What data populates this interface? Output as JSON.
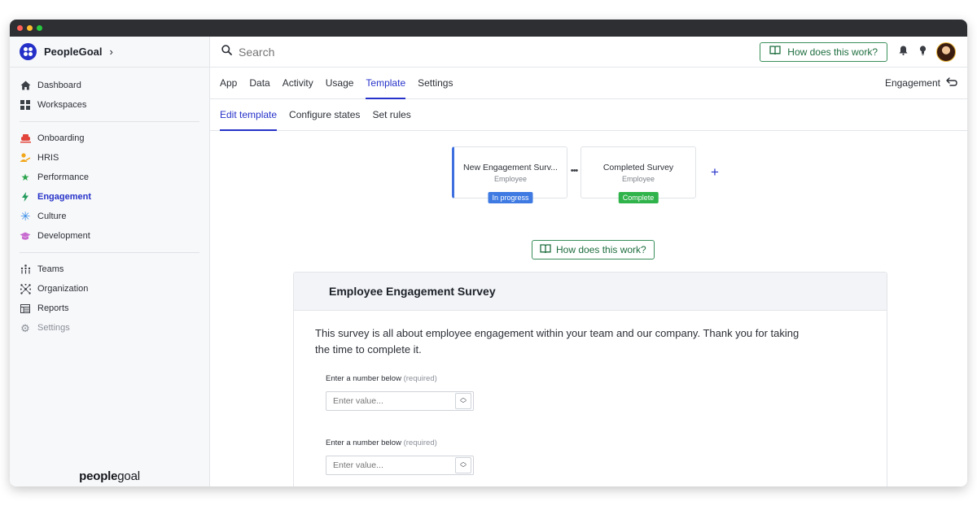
{
  "sidebar": {
    "brand": "PeopleGoal",
    "group1": [
      {
        "label": "Dashboard",
        "icon": "home-icon"
      },
      {
        "label": "Workspaces",
        "icon": "grid-icon"
      }
    ],
    "group2": [
      {
        "label": "Onboarding",
        "icon": "onboarding-icon"
      },
      {
        "label": "HRIS",
        "icon": "hris-icon"
      },
      {
        "label": "Performance",
        "icon": "star-icon"
      },
      {
        "label": "Engagement",
        "icon": "lightning-icon"
      },
      {
        "label": "Culture",
        "icon": "asterisk-icon"
      },
      {
        "label": "Development",
        "icon": "graduation-cap-icon"
      }
    ],
    "group3": [
      {
        "label": "Teams",
        "icon": "teams-icon"
      },
      {
        "label": "Organization",
        "icon": "organization-icon"
      },
      {
        "label": "Reports",
        "icon": "reports-icon"
      },
      {
        "label": "Settings",
        "icon": "gear-icon"
      }
    ],
    "footer_logo_bold": "people",
    "footer_logo_light": "goal"
  },
  "topbar": {
    "search_placeholder": "Search",
    "help_label": "How does this work?"
  },
  "tabs": [
    "App",
    "Data",
    "Activity",
    "Usage",
    "Template",
    "Settings"
  ],
  "active_tab": "Template",
  "context_label": "Engagement",
  "subtabs": [
    "Edit template",
    "Configure states",
    "Set rules"
  ],
  "states": [
    {
      "title": "New Engagement Surv...",
      "role": "Employee",
      "badge": "In progress"
    },
    {
      "title": "Completed Survey",
      "role": "Employee",
      "badge": "Complete"
    }
  ],
  "add_state": "+",
  "help_label_2": "How does this work?",
  "survey": {
    "title": "Employee Engagement Survey",
    "description": "This survey is all about employee engagement within your team and our company. Thank you for taking the time to complete it.",
    "fields": [
      {
        "label": "Enter a number below",
        "required": "(required)",
        "placeholder": "Enter value..."
      },
      {
        "label": "Enter a number below",
        "required": "(required)",
        "placeholder": "Enter value..."
      }
    ]
  },
  "colors": {
    "accent": "#2632c9",
    "help_border": "#3a8f5a",
    "in_progress": "#3e7ae2",
    "complete": "#2fb34a"
  }
}
